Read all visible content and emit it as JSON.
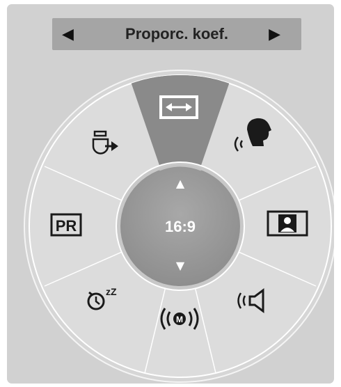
{
  "menu": {
    "title": "Proporc. koef.",
    "prev_label": "◀",
    "next_label": "▶"
  },
  "center": {
    "value": "16:9",
    "up_label": "▲",
    "down_label": "▼"
  },
  "wheel_items": [
    {
      "id": "aspect-ratio",
      "icon": "aspect-ratio-icon",
      "selected": true
    },
    {
      "id": "voice",
      "icon": "voice-speaking-icon",
      "selected": false
    },
    {
      "id": "picture",
      "icon": "picture-frame-icon",
      "selected": false
    },
    {
      "id": "sound",
      "icon": "speaker-icon",
      "selected": false
    },
    {
      "id": "mtsu",
      "icon": "mono-stereo-icon",
      "selected": false,
      "text": "M"
    },
    {
      "id": "sleep",
      "icon": "sleep-timer-icon",
      "selected": false,
      "text": "zZ"
    },
    {
      "id": "program",
      "icon": "program-list-icon",
      "selected": false,
      "text": "PR"
    },
    {
      "id": "input",
      "icon": "input-source-icon",
      "selected": false
    }
  ],
  "colors": {
    "panel": "#d1d1d1",
    "wheel": "#dcdcdc",
    "selected_segment": "#8a8a8a",
    "hub": "#9b9b9b",
    "icon": "#1a1a1a"
  }
}
